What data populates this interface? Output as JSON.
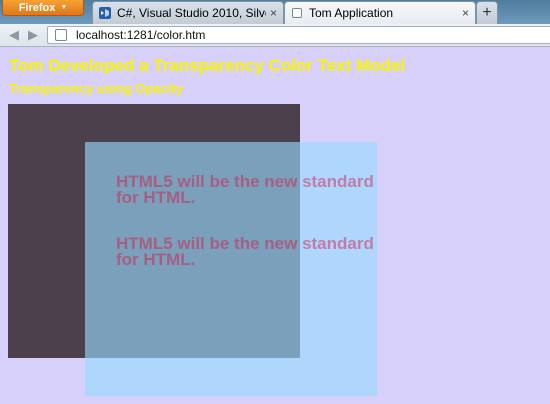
{
  "window": {
    "firefox_button_label": "Firefox",
    "tabs": [
      {
        "label": "C#, Visual Studio 2010, Silverl...",
        "active": false,
        "icon": "visual-studio-icon"
      },
      {
        "label": "Tom Application",
        "active": true,
        "icon": "blank-page-icon"
      }
    ],
    "close_glyph": "×",
    "new_tab_glyph": "+"
  },
  "nav": {
    "back_glyph": "◀",
    "forward_glyph": "▶",
    "url": "localhost:1281/color.htm"
  },
  "page": {
    "title": "Tom Developed a Transparency Color Text Model",
    "subtitle": "Transparency using Opacity",
    "messages": [
      "HTML5 will be the new standard for HTML.",
      "HTML5 will be the new standard for HTML."
    ]
  },
  "colors": {
    "page_background": "#d7d0fb",
    "heading_yellow": "#f9f500",
    "dark_box": "#18080a",
    "light_box": "#96dcff",
    "message_text": "#d71946"
  }
}
